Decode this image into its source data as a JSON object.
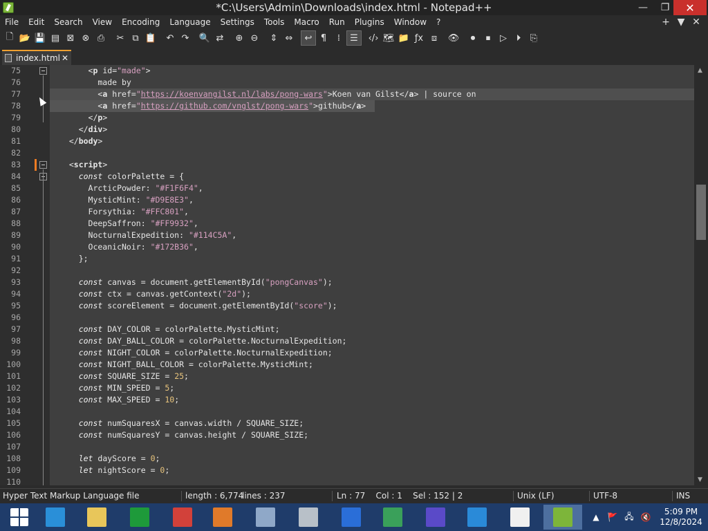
{
  "window": {
    "title": "*C:\\Users\\Admin\\Downloads\\index.html - Notepad++",
    "min_label": "—",
    "max_label": "❐",
    "close_label": "✕"
  },
  "menu": {
    "items": [
      "File",
      "Edit",
      "Search",
      "View",
      "Encoding",
      "Language",
      "Settings",
      "Tools",
      "Macro",
      "Run",
      "Plugins",
      "Window",
      "?"
    ],
    "extras": [
      "+",
      "▼",
      "✕"
    ]
  },
  "toolbar": {
    "icons": [
      {
        "name": "new-file-icon",
        "glyph": "🗋"
      },
      {
        "name": "open-file-icon",
        "glyph": "📂"
      },
      {
        "name": "save-icon",
        "glyph": "💾"
      },
      {
        "name": "save-all-icon",
        "glyph": "▤"
      },
      {
        "name": "close-icon",
        "glyph": "⊠"
      },
      {
        "name": "close-all-icon",
        "glyph": "⊗"
      },
      {
        "name": "print-icon",
        "glyph": "⎙"
      },
      {
        "name": "sep"
      },
      {
        "name": "cut-icon",
        "glyph": "✂"
      },
      {
        "name": "copy-icon",
        "glyph": "⧉"
      },
      {
        "name": "paste-icon",
        "glyph": "📋"
      },
      {
        "name": "sep"
      },
      {
        "name": "undo-icon",
        "glyph": "↶"
      },
      {
        "name": "redo-icon",
        "glyph": "↷"
      },
      {
        "name": "sep"
      },
      {
        "name": "find-icon",
        "glyph": "🔍"
      },
      {
        "name": "replace-icon",
        "glyph": "⇄"
      },
      {
        "name": "sep"
      },
      {
        "name": "zoom-in-icon",
        "glyph": "⊕"
      },
      {
        "name": "zoom-out-icon",
        "glyph": "⊖"
      },
      {
        "name": "sep"
      },
      {
        "name": "sync-vertical-icon",
        "glyph": "⇕"
      },
      {
        "name": "sync-horizontal-icon",
        "glyph": "⇔"
      },
      {
        "name": "sep"
      },
      {
        "name": "word-wrap-icon",
        "glyph": "↩"
      },
      {
        "name": "show-all-chars-icon",
        "glyph": "¶"
      },
      {
        "name": "indent-guide-icon",
        "glyph": "⁞"
      },
      {
        "name": "doc-map-icon",
        "glyph": "☰"
      },
      {
        "name": "sep"
      },
      {
        "name": "udl-icon",
        "glyph": "‹/›"
      },
      {
        "name": "function-map-icon",
        "glyph": "🗺"
      },
      {
        "name": "folder-workspace-icon",
        "glyph": "📁"
      },
      {
        "name": "function-list-icon",
        "glyph": "ƒx"
      },
      {
        "name": "doc-switcher-icon",
        "glyph": "⧈"
      },
      {
        "name": "sep"
      },
      {
        "name": "monitoring-icon",
        "glyph": "👁"
      },
      {
        "name": "sep"
      },
      {
        "name": "record-macro-icon",
        "glyph": "⏺"
      },
      {
        "name": "stop-macro-icon",
        "glyph": "⏹"
      },
      {
        "name": "play-macro-icon",
        "glyph": "▷"
      },
      {
        "name": "play-multi-macro-icon",
        "glyph": "⏵"
      },
      {
        "name": "save-macro-icon",
        "glyph": "⎘"
      }
    ]
  },
  "tab": {
    "label": "index.html",
    "close": "✕"
  },
  "editor": {
    "first_line": 75,
    "current_line": 77,
    "lines": [
      {
        "n": "75",
        "fold": true,
        "parts": [
          [
            "txt",
            "      "
          ],
          [
            "tag",
            "<"
          ],
          [
            "tagname",
            "p"
          ],
          [
            "attr",
            " id="
          ],
          [
            "str",
            "\"made\""
          ],
          [
            "tag",
            ">"
          ]
        ]
      },
      {
        "n": "76",
        "parts": [
          [
            "txt",
            "        made by"
          ]
        ]
      },
      {
        "n": "77",
        "parts": [
          [
            "txt",
            "        "
          ],
          [
            "tag",
            "<"
          ],
          [
            "tagname",
            "a"
          ],
          [
            "attr",
            " href="
          ],
          [
            "str",
            "\""
          ],
          [
            "url",
            "https://koenvangilst.nl/labs/pong-wars"
          ],
          [
            "str",
            "\""
          ],
          [
            "tag",
            ">"
          ],
          [
            "txt",
            "Koen van Gilst"
          ],
          [
            "tag",
            "</"
          ],
          [
            "tagname",
            "a"
          ],
          [
            "tag",
            ">"
          ],
          [
            "txt",
            " | source on"
          ]
        ]
      },
      {
        "n": "78",
        "parts": [
          [
            "txt",
            "        "
          ],
          [
            "tag",
            "<"
          ],
          [
            "tagname",
            "a"
          ],
          [
            "attr",
            " href="
          ],
          [
            "str",
            "\""
          ],
          [
            "url",
            "https://github.com/vnglst/pong-wars"
          ],
          [
            "str",
            "\""
          ],
          [
            "tag",
            ">"
          ],
          [
            "txt",
            "github"
          ],
          [
            "tag",
            "</"
          ],
          [
            "tagname",
            "a"
          ],
          [
            "tag",
            ">"
          ]
        ]
      },
      {
        "n": "79",
        "parts": [
          [
            "txt",
            "      "
          ],
          [
            "tag",
            "</"
          ],
          [
            "tagname",
            "p"
          ],
          [
            "tag",
            ">"
          ]
        ]
      },
      {
        "n": "80",
        "parts": [
          [
            "txt",
            "    "
          ],
          [
            "tag",
            "</"
          ],
          [
            "tagname",
            "div"
          ],
          [
            "tag",
            ">"
          ]
        ]
      },
      {
        "n": "81",
        "parts": [
          [
            "txt",
            "  "
          ],
          [
            "tag",
            "</"
          ],
          [
            "tagname",
            "body"
          ],
          [
            "tag",
            ">"
          ]
        ]
      },
      {
        "n": "82",
        "parts": []
      },
      {
        "n": "83",
        "fold": true,
        "change": true,
        "parts": [
          [
            "txt",
            "  "
          ],
          [
            "tag",
            "<"
          ],
          [
            "tagname",
            "script"
          ],
          [
            "tag",
            ">"
          ]
        ]
      },
      {
        "n": "84",
        "fold": true,
        "parts": [
          [
            "txt",
            "    "
          ],
          [
            "kw",
            "const"
          ],
          [
            "txt",
            " colorPalette = {"
          ]
        ]
      },
      {
        "n": "85",
        "parts": [
          [
            "txt",
            "      ArcticPowder: "
          ],
          [
            "str",
            "\"#F1F6F4\""
          ],
          [
            "txt",
            ","
          ]
        ]
      },
      {
        "n": "86",
        "parts": [
          [
            "txt",
            "      MysticMint: "
          ],
          [
            "str",
            "\"#D9E8E3\""
          ],
          [
            "txt",
            ","
          ]
        ]
      },
      {
        "n": "87",
        "parts": [
          [
            "txt",
            "      Forsythia: "
          ],
          [
            "str",
            "\"#FFC801\""
          ],
          [
            "txt",
            ","
          ]
        ]
      },
      {
        "n": "88",
        "parts": [
          [
            "txt",
            "      DeepSaffron: "
          ],
          [
            "str",
            "\"#FF9932\""
          ],
          [
            "txt",
            ","
          ]
        ]
      },
      {
        "n": "89",
        "parts": [
          [
            "txt",
            "      NocturnalExpedition: "
          ],
          [
            "str",
            "\"#114C5A\""
          ],
          [
            "txt",
            ","
          ]
        ]
      },
      {
        "n": "90",
        "parts": [
          [
            "txt",
            "      OceanicNoir: "
          ],
          [
            "str",
            "\"#172B36\""
          ],
          [
            "txt",
            ","
          ]
        ]
      },
      {
        "n": "91",
        "parts": [
          [
            "txt",
            "    };"
          ]
        ]
      },
      {
        "n": "92",
        "parts": []
      },
      {
        "n": "93",
        "parts": [
          [
            "txt",
            "    "
          ],
          [
            "kw",
            "const"
          ],
          [
            "txt",
            " canvas = document.getElementById("
          ],
          [
            "str",
            "\"pongCanvas\""
          ],
          [
            "txt",
            ");"
          ]
        ]
      },
      {
        "n": "94",
        "parts": [
          [
            "txt",
            "    "
          ],
          [
            "kw",
            "const"
          ],
          [
            "txt",
            " ctx = canvas.getContext("
          ],
          [
            "str",
            "\"2d\""
          ],
          [
            "txt",
            ");"
          ]
        ]
      },
      {
        "n": "95",
        "parts": [
          [
            "txt",
            "    "
          ],
          [
            "kw",
            "const"
          ],
          [
            "txt",
            " scoreElement = document.getElementById("
          ],
          [
            "str",
            "\"score\""
          ],
          [
            "txt",
            ");"
          ]
        ]
      },
      {
        "n": "96",
        "parts": []
      },
      {
        "n": "97",
        "parts": [
          [
            "txt",
            "    "
          ],
          [
            "kw",
            "const"
          ],
          [
            "txt",
            " DAY_COLOR = colorPalette.MysticMint;"
          ]
        ]
      },
      {
        "n": "98",
        "parts": [
          [
            "txt",
            "    "
          ],
          [
            "kw",
            "const"
          ],
          [
            "txt",
            " DAY_BALL_COLOR = colorPalette.NocturnalExpedition;"
          ]
        ]
      },
      {
        "n": "99",
        "parts": [
          [
            "txt",
            "    "
          ],
          [
            "kw",
            "const"
          ],
          [
            "txt",
            " NIGHT_COLOR = colorPalette.NocturnalExpedition;"
          ]
        ]
      },
      {
        "n": "100",
        "parts": [
          [
            "txt",
            "    "
          ],
          [
            "kw",
            "const"
          ],
          [
            "txt",
            " NIGHT_BALL_COLOR = colorPalette.MysticMint;"
          ]
        ]
      },
      {
        "n": "101",
        "parts": [
          [
            "txt",
            "    "
          ],
          [
            "kw",
            "const"
          ],
          [
            "txt",
            " SQUARE_SIZE = "
          ],
          [
            "num",
            "25"
          ],
          [
            "txt",
            ";"
          ]
        ]
      },
      {
        "n": "102",
        "parts": [
          [
            "txt",
            "    "
          ],
          [
            "kw",
            "const"
          ],
          [
            "txt",
            " MIN_SPEED = "
          ],
          [
            "num",
            "5"
          ],
          [
            "txt",
            ";"
          ]
        ]
      },
      {
        "n": "103",
        "parts": [
          [
            "txt",
            "    "
          ],
          [
            "kw",
            "const"
          ],
          [
            "txt",
            " MAX_SPEED = "
          ],
          [
            "num",
            "10"
          ],
          [
            "txt",
            ";"
          ]
        ]
      },
      {
        "n": "104",
        "parts": []
      },
      {
        "n": "105",
        "parts": [
          [
            "txt",
            "    "
          ],
          [
            "kw",
            "const"
          ],
          [
            "txt",
            " numSquaresX = canvas.width / SQUARE_SIZE;"
          ]
        ]
      },
      {
        "n": "106",
        "parts": [
          [
            "txt",
            "    "
          ],
          [
            "kw",
            "const"
          ],
          [
            "txt",
            " numSquaresY = canvas.height / SQUARE_SIZE;"
          ]
        ]
      },
      {
        "n": "107",
        "parts": []
      },
      {
        "n": "108",
        "parts": [
          [
            "txt",
            "    "
          ],
          [
            "kw",
            "let"
          ],
          [
            "txt",
            " dayScore = "
          ],
          [
            "num",
            "0"
          ],
          [
            "txt",
            ";"
          ]
        ]
      },
      {
        "n": "109",
        "parts": [
          [
            "txt",
            "    "
          ],
          [
            "kw",
            "let"
          ],
          [
            "txt",
            " nightScore = "
          ],
          [
            "num",
            "0"
          ],
          [
            "txt",
            ";"
          ]
        ]
      },
      {
        "n": "110",
        "parts": []
      }
    ]
  },
  "statusbar": {
    "file_type": "Hyper Text Markup Language file",
    "length": "length : 6,774",
    "lines": "lines : 237",
    "position": "Ln : 77    Col : 1    Sel : 152 | 2",
    "eol": "Unix (LF)",
    "encoding": "UTF-8",
    "mode": "INS"
  },
  "taskbar": {
    "apps": [
      {
        "name": "start-button",
        "color": "#1f3c6a"
      },
      {
        "name": "internet-explorer-icon",
        "color": "#2a8fd8"
      },
      {
        "name": "file-explorer-icon",
        "color": "#e8c65a"
      },
      {
        "name": "store-icon",
        "color": "#1e9a3a"
      },
      {
        "name": "app-red-icon",
        "color": "#d2413a"
      },
      {
        "name": "media-player-icon",
        "color": "#e07a2a"
      },
      {
        "name": "performance-monitor-icon",
        "color": "#8fa8c8"
      },
      {
        "name": "recycle-bin-icon",
        "color": "#b8c0c8"
      },
      {
        "name": "security-shield-icon",
        "color": "#2a6ed8"
      },
      {
        "name": "network-icon",
        "color": "#3aa05a"
      },
      {
        "name": "settings-gear-icon",
        "color": "#5a4ac8"
      },
      {
        "name": "onedrive-icon",
        "color": "#2a8ad8"
      },
      {
        "name": "blank-document-icon",
        "color": "#f0f0f0"
      },
      {
        "name": "notepad-plus-plus-icon",
        "color": "#7db53a"
      }
    ],
    "tray_icons": [
      "▲",
      "🚩",
      "🖧",
      "🔇"
    ],
    "time": "5:09 PM",
    "date": "12/8/2024"
  }
}
